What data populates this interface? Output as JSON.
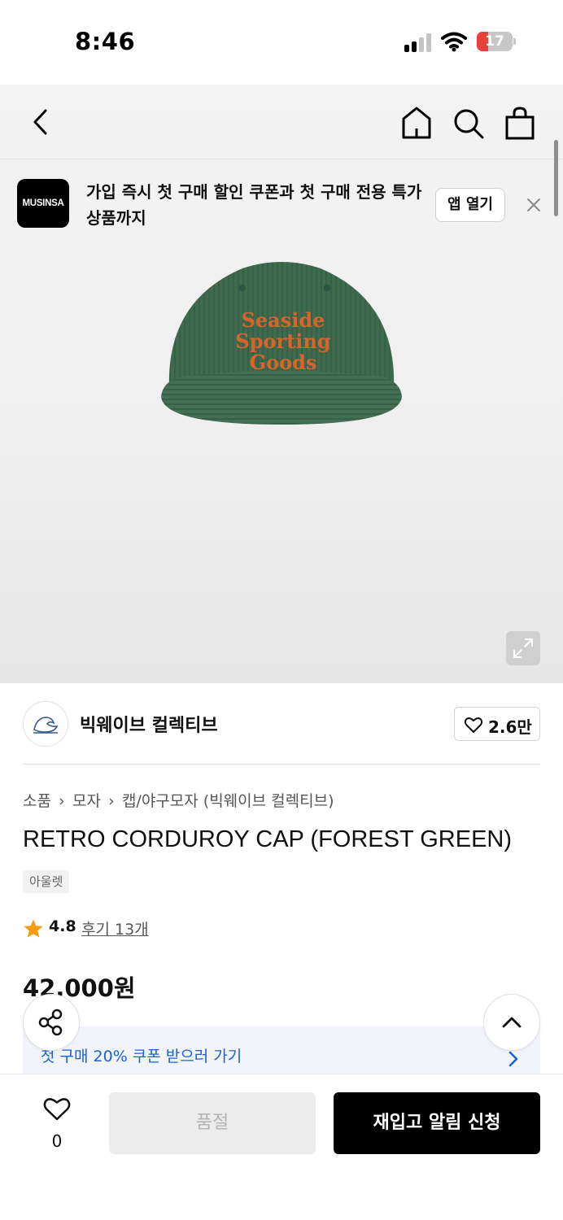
{
  "status_bar": {
    "time": "8:46",
    "battery_level": "17"
  },
  "nav": {
    "icons": [
      "back-arrow-icon",
      "home-icon",
      "search-icon",
      "shopping-bag-icon"
    ]
  },
  "promo": {
    "logo_text": "MUSINSA",
    "message": "가입 즉시 첫 구매 할인 쿠폰과 첫 구매 전용 특가 상품까지",
    "open_app_label": "앱 열기"
  },
  "product_image": {
    "embroidery_lines": [
      "Seaside",
      "Sporting",
      "Goods"
    ],
    "cap_color": "#3f6b4c",
    "embroidery_color": "#d9642b"
  },
  "brand": {
    "name": "빅웨이브 컬렉티브",
    "like_count": "2.6만"
  },
  "breadcrumb": [
    "소품",
    "모자",
    "캡/야구모자 (빅웨이브 컬렉티브)"
  ],
  "product": {
    "title": "RETRO CORDUROY CAP (FOREST GREEN)",
    "badge": "아울렛",
    "rating": "4.8",
    "reviews_label": "후기 13개",
    "price": "42,000원"
  },
  "coupon": {
    "text": "첫 구매 20% 쿠폰 받으러 가기"
  },
  "bottom_bar": {
    "wish_count": "0",
    "soldout_label": "품절",
    "restock_label": "재입고 알림 신청"
  },
  "colors": {
    "accent_blue": "#1d5fd6",
    "star": "#f39c12",
    "primary_button": "#000000"
  }
}
